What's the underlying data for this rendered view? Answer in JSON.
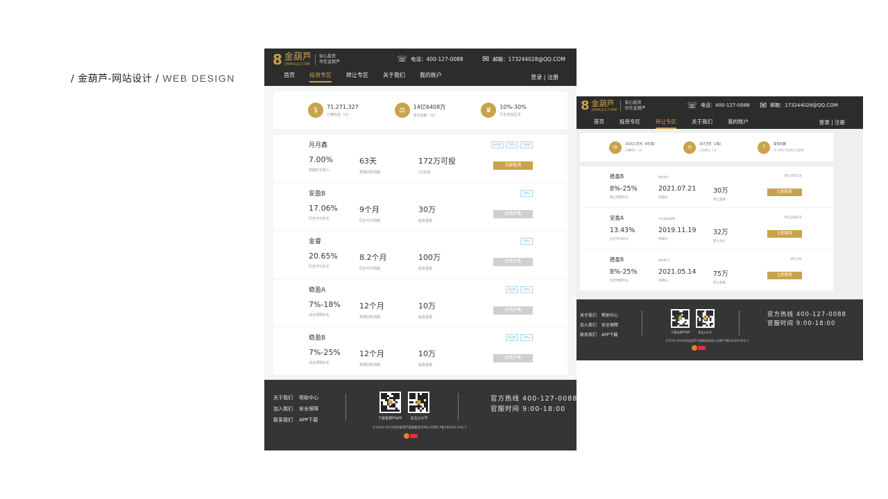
{
  "caption": {
    "zh": "/ 金葫芦-网站设计 /",
    "en": "WEB DESIGN"
  },
  "brand": {
    "mark": "8",
    "name": "金葫芦",
    "pinyin": "JINHULU.COM",
    "slogan1": "安心投资",
    "slogan2": "尽在金葫芦",
    "gold": "#c9a34a"
  },
  "contact": {
    "phone": "电话：400-127-0088",
    "email": "邮箱：173244028@QQ.COM"
  },
  "nav": [
    "首页",
    "投资专区",
    "转让专区",
    "关于我们",
    "我的账户"
  ],
  "login": "登录 | 注册",
  "stats": [
    {
      "value": "71,271,327",
      "label": "已赚收益（元）"
    },
    {
      "value": "14亿6408万",
      "label": "成交金额（元）"
    },
    {
      "value": "10%-30%",
      "label": "历史收益区间"
    }
  ],
  "products": [
    {
      "name": "月月鑫",
      "tags": [
        "低风险",
        "可转让",
        "可复投"
      ],
      "rate": "7.00%",
      "rate_label": "预期年化收入",
      "term": "63天",
      "term_label": "预期回款周期",
      "amount": "172万可投",
      "amount_label": "1万起投",
      "button": "立即投资",
      "active": true
    },
    {
      "name": "安盈B",
      "tags": [
        "可转让"
      ],
      "rate": "17.06%",
      "rate_label": "历史平均年化",
      "term": "9个月",
      "term_label": "历史平均周期",
      "amount": "30万",
      "amount_label": "起投金额",
      "button": "即将开售",
      "active": false
    },
    {
      "name": "金睿",
      "tags": [
        "可转让"
      ],
      "rate": "20.65%",
      "rate_label": "历史平均年化",
      "term": "8.2个月",
      "term_label": "历史平均周期",
      "amount": "100万",
      "amount_label": "起投金额",
      "button": "即将开售",
      "active": false
    },
    {
      "name": "稳盈A",
      "tags": [
        "低风险",
        "可转让"
      ],
      "rate": "7%-18%",
      "rate_label": "综合预期年化",
      "term": "12个月",
      "term_label": "预期回款周期",
      "amount": "10万",
      "amount_label": "起投金额",
      "button": "即将开售",
      "active": false
    },
    {
      "name": "稳盈B",
      "tags": [
        "低风险",
        "可转让"
      ],
      "rate": "7%-25%",
      "rate_label": "综合预期年化",
      "term": "12个月",
      "term_label": "预期回款周期",
      "amount": "10万",
      "amount_label": "起投金额",
      "button": "即将开售",
      "active": false
    }
  ],
  "footer": {
    "links": [
      "关于我们",
      "帮助中心",
      "加入我们",
      "安全保障",
      "联系我们",
      "APP下载"
    ],
    "qr1": "下载金葫芦APP",
    "qr2": "关注公众号",
    "hotline": "官方热线  400-127-0088",
    "hours": "官服时间  9:00-18:00",
    "copyright": "©2016-2019深圳金葫芦金融服务有限公司粤ICP备16036134号-1"
  },
  "stats2": [
    {
      "value": "101亿1万元（6亿笔）",
      "label": "已赚转让（元）"
    },
    {
      "value": "107万元（2笔）",
      "label": "正在转让（元）"
    },
    {
      "value": "常见问题",
      "label": "关于转让专区的几点说明"
    }
  ],
  "transfers": [
    {
      "name": "稳盈B",
      "rate_sub": "",
      "rate": "8%-25%",
      "rate_label": "转让预期年化",
      "date_sub": "剩余期 4",
      "date": "2021.07.21",
      "date_label": "到期日",
      "amount": "30万",
      "amount_label": "转让金额",
      "note": "转让承诺3天",
      "button": "立即投资"
    },
    {
      "name": "安盈A",
      "rate_sub": "",
      "rate": "13.43%",
      "rate_label": "历史平均年化",
      "date_sub": "中山国际配置",
      "date": "2019.11.19",
      "date_label": "到期日",
      "amount": "32万",
      "amount_label": "转让总价",
      "note": "转让返现0天",
      "button": "立即投资"
    },
    {
      "name": "稳盈B",
      "rate_sub": "",
      "rate": "8%-25%",
      "rate_label": "综合预期年化",
      "date_sub": "剩余期 3",
      "date": "2021.05.14",
      "date_label": "到期日",
      "amount": "75万",
      "amount_label": "转让金额",
      "note": "转让0天",
      "button": "立即投资"
    }
  ]
}
